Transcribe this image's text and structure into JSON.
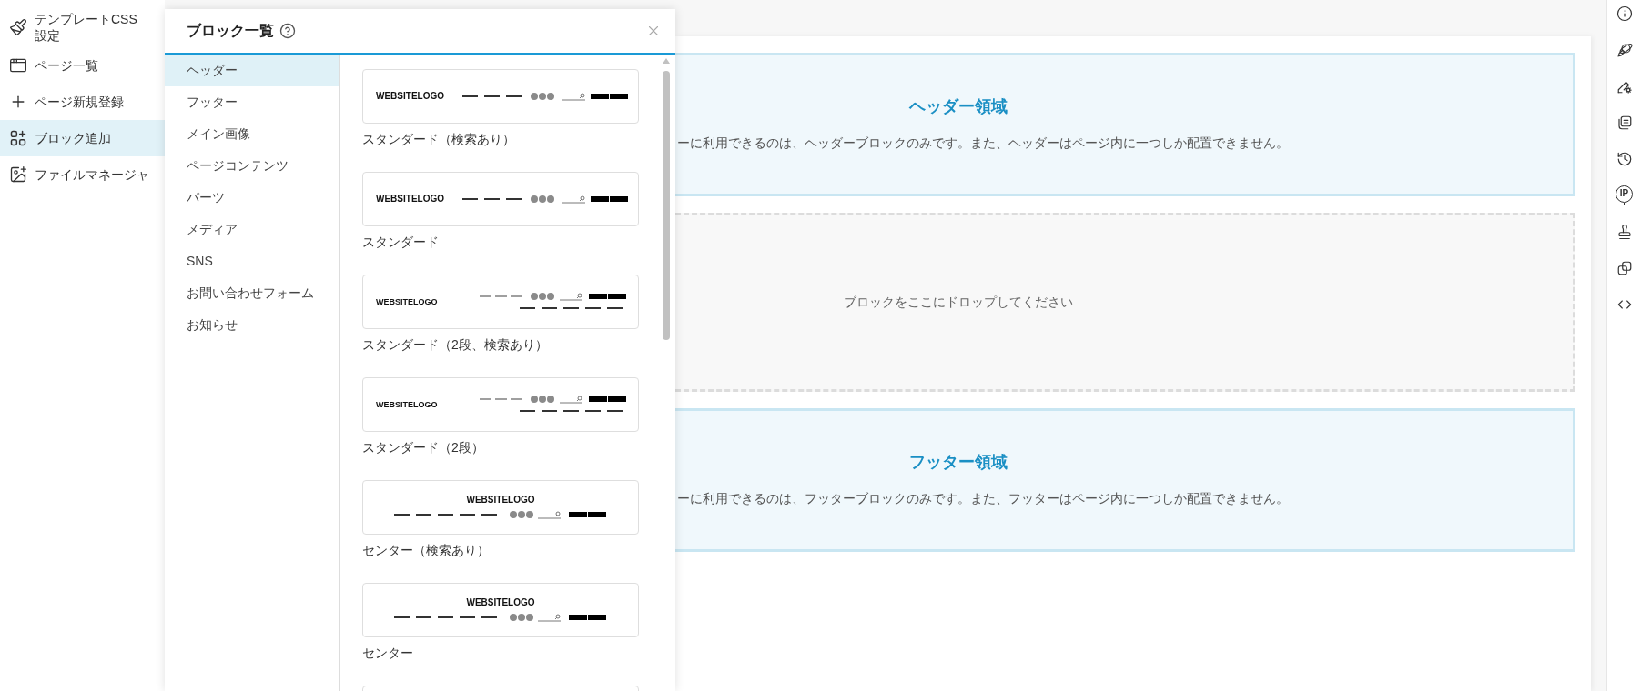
{
  "sidebar": {
    "items": [
      {
        "label": "テンプレートCSS設定",
        "selected": false
      },
      {
        "label": "ページ一覧",
        "selected": false
      },
      {
        "label": "ページ新規登録",
        "selected": false
      },
      {
        "label": "ブロック追加",
        "selected": true
      },
      {
        "label": "ファイルマネージャ",
        "selected": false
      }
    ]
  },
  "block_panel": {
    "title": "ブロック一覧",
    "categories": [
      {
        "label": "ヘッダー",
        "selected": true
      },
      {
        "label": "フッター",
        "selected": false
      },
      {
        "label": "メイン画像",
        "selected": false
      },
      {
        "label": "ページコンテンツ",
        "selected": false
      },
      {
        "label": "パーツ",
        "selected": false
      },
      {
        "label": "メディア",
        "selected": false
      },
      {
        "label": "SNS",
        "selected": false
      },
      {
        "label": "お問い合わせフォーム",
        "selected": false
      },
      {
        "label": "お知らせ",
        "selected": false
      }
    ],
    "blocks": [
      {
        "label": "スタンダード（検索あり）",
        "kind": "standard",
        "logo": "WEBSITELOGO"
      },
      {
        "label": "スタンダード",
        "kind": "standard",
        "logo": "WEBSITELOGO"
      },
      {
        "label": "スタンダード（2段、検索あり）",
        "kind": "two_row",
        "logo": "WEBSITELOGO"
      },
      {
        "label": "スタンダード（2段）",
        "kind": "two_row",
        "logo": "WEBSITELOGO"
      },
      {
        "label": "センター（検索あり）",
        "kind": "center",
        "logo": "WEBSITELOGO"
      },
      {
        "label": "センター",
        "kind": "center",
        "logo": "WEBSITELOGO"
      }
    ]
  },
  "canvas": {
    "header_area": {
      "title": "ヘッダー領域",
      "description": "ーに利用できるのは、ヘッダーブロックのみです。また、ヘッダーはページ内に一つしか配置できません。"
    },
    "drop_zone": {
      "text": "ブロックをここにドロップしてください"
    },
    "footer_area": {
      "title": "フッター領域",
      "description": "ーに利用できるのは、フッターブロックのみです。また、フッターはページ内に一つしか配置できません。"
    }
  },
  "right_toolbar": {
    "ip_badge": "IP"
  }
}
